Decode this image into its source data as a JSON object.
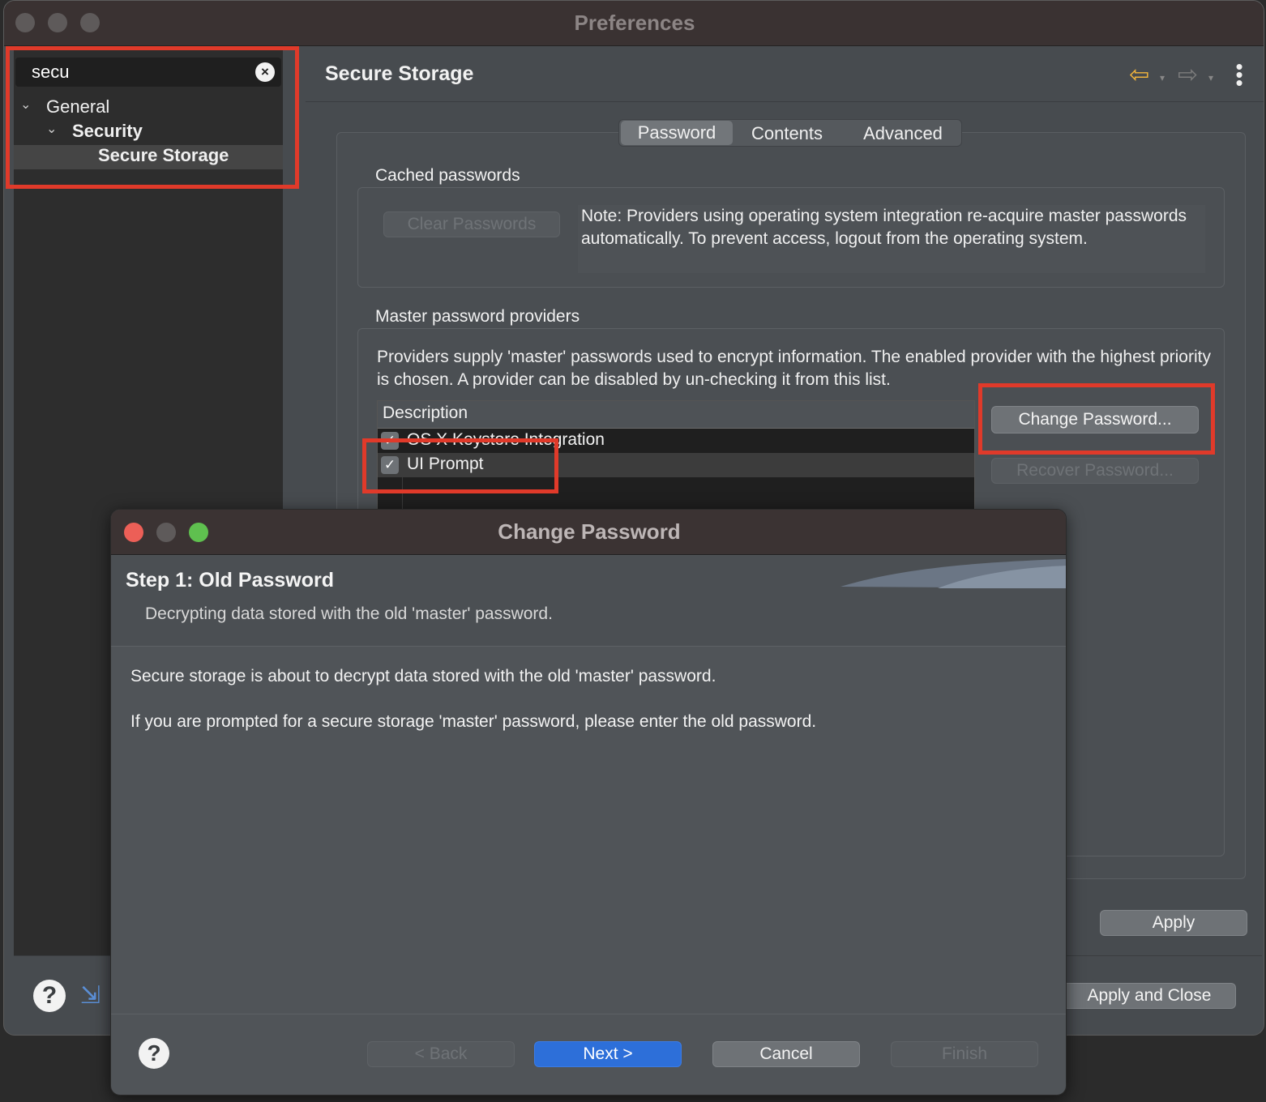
{
  "window": {
    "title": "Preferences"
  },
  "sidebar": {
    "search_value": "secu",
    "tree": [
      {
        "label": "General"
      },
      {
        "label": "Security"
      },
      {
        "label": "Secure Storage"
      }
    ]
  },
  "page": {
    "title": "Secure Storage",
    "tabs": [
      {
        "label": "Password"
      },
      {
        "label": "Contents"
      },
      {
        "label": "Advanced"
      }
    ],
    "cached": {
      "label": "Cached passwords",
      "clear_button": "Clear Passwords",
      "note": "Note: Providers using operating system integration re-acquire master passwords automatically. To prevent access, logout from the operating system."
    },
    "providers": {
      "label": "Master password providers",
      "description": "Providers supply 'master' passwords used to encrypt information. The enabled provider with the highest priority is chosen. A provider can be disabled by un-checking it from this list.",
      "table_header": "Description",
      "rows": [
        {
          "label": "OS X Keystore Integration",
          "checked": true
        },
        {
          "label": "UI Prompt",
          "checked": true
        }
      ],
      "change_button": "Change Password...",
      "recover_button": "Recover Password..."
    },
    "apply_button": "Apply",
    "apply_close_button": "Apply and Close"
  },
  "dialog": {
    "title": "Change Password",
    "step_title": "Step 1: Old Password",
    "step_description": "Decrypting data stored with the old 'master' password.",
    "message1": "Secure storage is about to decrypt data stored with the old 'master' password.",
    "message2": "If you are prompted for a secure storage 'master' password, please enter the old password.",
    "buttons": {
      "back": "< Back",
      "next": "Next >",
      "cancel": "Cancel",
      "finish": "Finish"
    }
  },
  "icons": {
    "clear": "×",
    "checkmark": "✓",
    "help": "?",
    "back_arrow": "⇦",
    "forward_arrow": "⇨",
    "menu": "⋮",
    "import": "⇲",
    "chevron": "⌄"
  },
  "colors": {
    "highlight": "#e03a2a",
    "primary_button": "#2d6fd9",
    "back_arrow": "#f0b43c"
  }
}
